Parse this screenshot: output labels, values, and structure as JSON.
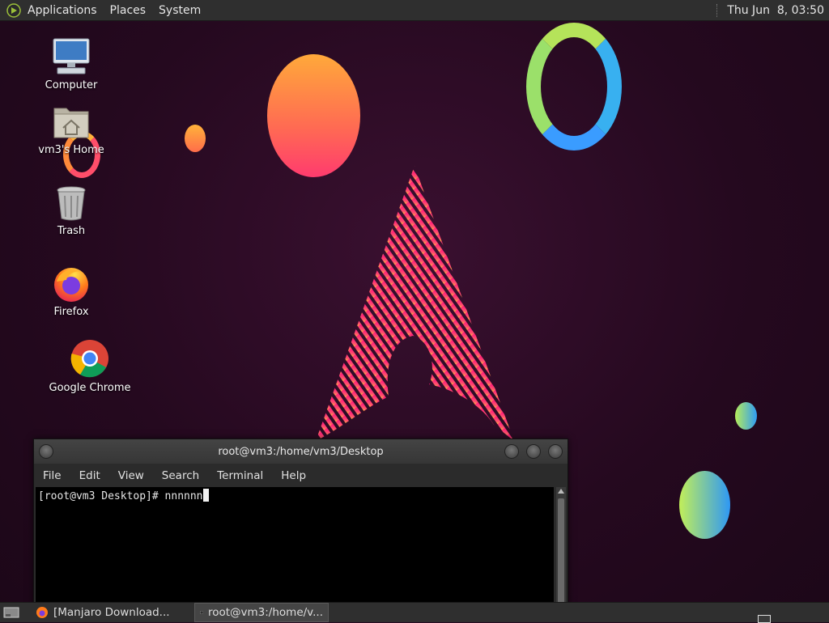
{
  "top_panel": {
    "menus": [
      "Applications",
      "Places",
      "System"
    ],
    "clock": "Thu Jun  8, 03:50"
  },
  "desktop_icons": [
    {
      "label": "Computer",
      "icon": "computer-icon"
    },
    {
      "label": "vm3's Home",
      "icon": "home-folder-icon"
    },
    {
      "label": "Trash",
      "icon": "trash-icon"
    },
    {
      "label": "Firefox",
      "icon": "firefox-icon"
    },
    {
      "label": "Google Chrome",
      "icon": "chrome-icon"
    }
  ],
  "terminal": {
    "title": "root@vm3:/home/vm3/Desktop",
    "menus": [
      "File",
      "Edit",
      "View",
      "Search",
      "Terminal",
      "Help"
    ],
    "prompt": "[root@vm3 Desktop]# ",
    "input": "nnnnnn"
  },
  "taskbar": {
    "items": [
      {
        "label": "[Manjaro Download...",
        "icon": "firefox-icon",
        "active": false
      },
      {
        "label": "root@vm3:/home/v...",
        "icon": "terminal-icon",
        "active": true
      }
    ]
  },
  "colors": {
    "background": "#25091f",
    "panel": "#2f2f2f",
    "accent_pink": "#ff2f7a",
    "accent_orange": "#ffa93a",
    "accent_blue": "#3aa8ff"
  }
}
